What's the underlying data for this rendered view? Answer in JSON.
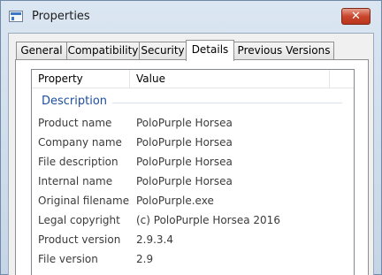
{
  "window": {
    "title": "Properties",
    "close_glyph": "✕"
  },
  "tabs": [
    {
      "label": "General"
    },
    {
      "label": "Compatibility"
    },
    {
      "label": "Security"
    },
    {
      "label": "Details"
    },
    {
      "label": "Previous Versions"
    }
  ],
  "details": {
    "columns": {
      "property": "Property",
      "value": "Value"
    },
    "group": "Description",
    "rows": [
      {
        "property": "Product name",
        "value": "PoloPurple Horsea"
      },
      {
        "property": "Company name",
        "value": "PoloPurple Horsea"
      },
      {
        "property": "File description",
        "value": "PoloPurple Horsea"
      },
      {
        "property": "Internal name",
        "value": "PoloPurple Horsea"
      },
      {
        "property": "Original filename",
        "value": "PoloPurple.exe"
      },
      {
        "property": "Legal copyright",
        "value": "(c) PoloPurple Horsea 2016"
      },
      {
        "property": "Product version",
        "value": "2.9.3.4"
      },
      {
        "property": "File version",
        "value": "2.9"
      }
    ]
  },
  "colors": {
    "group_header": "#1e4e9a",
    "close_button": "#c9462c"
  }
}
